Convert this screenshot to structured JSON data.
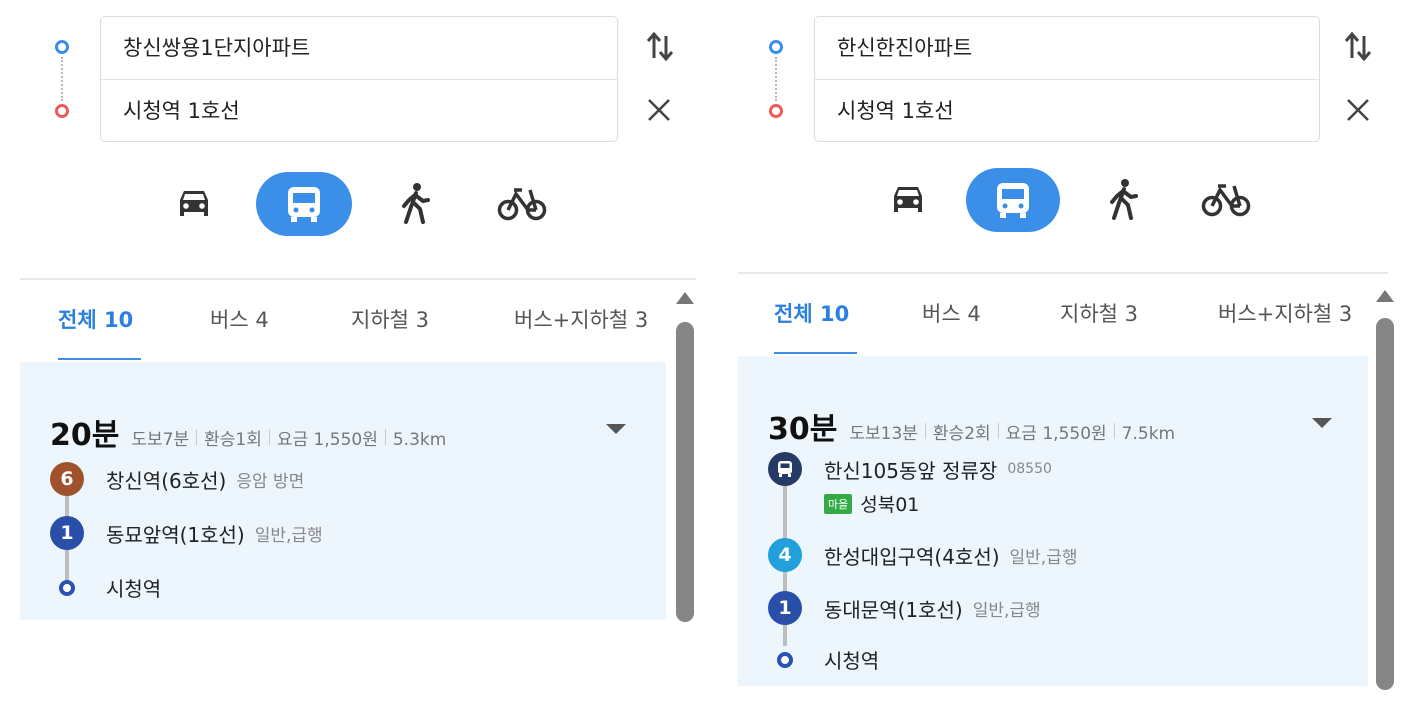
{
  "colors": {
    "accent": "#3b8fe8",
    "line6": "#a0522d",
    "line1": "#2a4fa8",
    "line4": "#21a0db",
    "bus_stop": "#263a66",
    "village_bus": "#33aa44",
    "origin": "#3b8fe8",
    "destination": "#ee5a5a"
  },
  "modes": {
    "car": "car-icon",
    "bus": "bus-icon",
    "walk": "walk-icon",
    "bike": "bike-icon"
  },
  "left": {
    "origin": "창신쌍용1단지아파트",
    "destination": "시청역 1호선",
    "tabs": [
      "전체 10",
      "버스 4",
      "지하철 3",
      "버스+지하철 3"
    ],
    "result": {
      "time": "20분",
      "walk": "도보7분",
      "transfer": "환승1회",
      "fare": "요금 1,550원",
      "distance": "5.3km",
      "steps": [
        {
          "badge": "6",
          "name": "창신역(6호선)",
          "sub": "응암 방면"
        },
        {
          "badge": "1",
          "name": "동묘앞역(1호선)",
          "sub": "일반,급행"
        },
        {
          "name": "시청역"
        }
      ]
    }
  },
  "right": {
    "origin": "한신한진아파트",
    "destination": "시청역 1호선",
    "tabs": [
      "전체 10",
      "버스 4",
      "지하철 3",
      "버스+지하철 3"
    ],
    "result": {
      "time": "30분",
      "walk": "도보13분",
      "transfer": "환승2회",
      "fare": "요금 1,550원",
      "distance": "7.5km",
      "steps": [
        {
          "name": "한신105동앞 정류장",
          "sub": "08550",
          "bus_tag": "마을",
          "bus_name": "성북01"
        },
        {
          "badge": "4",
          "name": "한성대입구역(4호선)",
          "sub": "일반,급행"
        },
        {
          "badge": "1",
          "name": "동대문역(1호선)",
          "sub": "일반,급행"
        },
        {
          "name": "시청역"
        }
      ]
    }
  }
}
